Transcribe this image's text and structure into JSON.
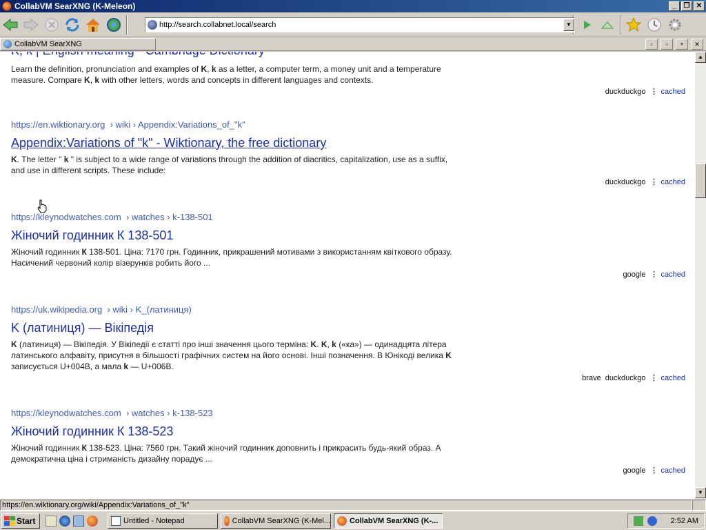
{
  "window": {
    "title": "CollabVM SearXNG (K-Meleon)",
    "min": "_",
    "max": "❐",
    "close": "✕"
  },
  "address": {
    "url": "http://search.collabnet.local/search"
  },
  "tab": {
    "label": "CollabVM SearXNG"
  },
  "top_partial_title": "K, k | English meaning - Cambridge Dictionary",
  "top_snippet_l1_pre": "Learn the definition, pronunciation and examples of ",
  "top_snippet_l1_b1": "K",
  "top_snippet_l1_mid": ", ",
  "top_snippet_l1_b2": "k",
  "top_snippet_l1_post": " as a letter, a computer term, a money unit and a temperature",
  "top_snippet_l2_pre": "measure. Compare ",
  "top_snippet_l2_b1": "K",
  "top_snippet_l2_mid": ", ",
  "top_snippet_l2_b2": "k",
  "top_snippet_l2_post": " with other letters, words and concepts in different languages and contexts.",
  "top_engine": "duckduckgo",
  "cached_label": "cached",
  "dots": "⋮",
  "results": [
    {
      "host": "https://en.wiktionary.org",
      "path": "› wiki › Appendix:Variations_of_\"k\"",
      "title": "Appendix:Variations of \"k\" - Wiktionary, the free dictionary",
      "s1b": "K",
      "s1": ". The letter \" ",
      "s1b2": "k",
      "s1c": " \" is subject to a wide range of variations through the addition of diacritics, capitalization, use as a suffix,",
      "s2": "and use in different scripts. These include:",
      "engines": [
        "duckduckgo"
      ]
    },
    {
      "host": "https://kleynodwatches.com",
      "path": "› watches › k-138-501",
      "title": "Жіночий годинник К 138-501",
      "s1pre": "Жіночий годинник ",
      "s1b": "К",
      "s1": " 138-501. Ціна: 7170 грн. Годинник, прикрашений мотивами з використанням квіткового образу.",
      "s2": "Насичений червоний колір візерунків робить його ...",
      "engines": [
        "google"
      ]
    },
    {
      "host": "https://uk.wikipedia.org",
      "path": "› wiki › K_(латиниця)",
      "title": "K (латиниця) — Вікіпедія",
      "s1b": "K",
      "s1": " (латиниця) — Вікіпедія. У Вікіпедії є статті про інші значення цього терміна: ",
      "s1b2": "K",
      "s1c": ". ",
      "s1b3": "K",
      "s1d": ", ",
      "s1b4": "k",
      "s1e": " («ка») — одинадцята літера",
      "s2": "латинського алфавіту, присутня в більшості графічних систем на його основі. Інші позначення. В Юнікоді велика ",
      "s2b": "K",
      "s3pre": "записується U+004B, а мала ",
      "s3b": "k",
      "s3": " — U+006B.",
      "engines": [
        "brave",
        "duckduckgo"
      ]
    },
    {
      "host": "https://kleynodwatches.com",
      "path": "› watches › k-138-523",
      "title": "Жіночий годинник К 138-523",
      "s1pre": "Жіночий годинник ",
      "s1b": "К",
      "s1": " 138-523. Ціна: 7560 грн. Такий жіночий годинник доповнить і прикрасить будь-який образ. А",
      "s2": "демократична ціна і стриманість дизайну порадує ...",
      "engines": [
        "google"
      ]
    }
  ],
  "status": {
    "text": "https://en.wiktionary.org/wiki/Appendix:Variations_of_\"k\""
  },
  "taskbar": {
    "start": "Start",
    "tasks": [
      "Untitled - Notepad",
      "CollabVM SearXNG (K-Mel...",
      "CollabVM SearXNG (K-..."
    ],
    "clock": "2:52 AM"
  }
}
